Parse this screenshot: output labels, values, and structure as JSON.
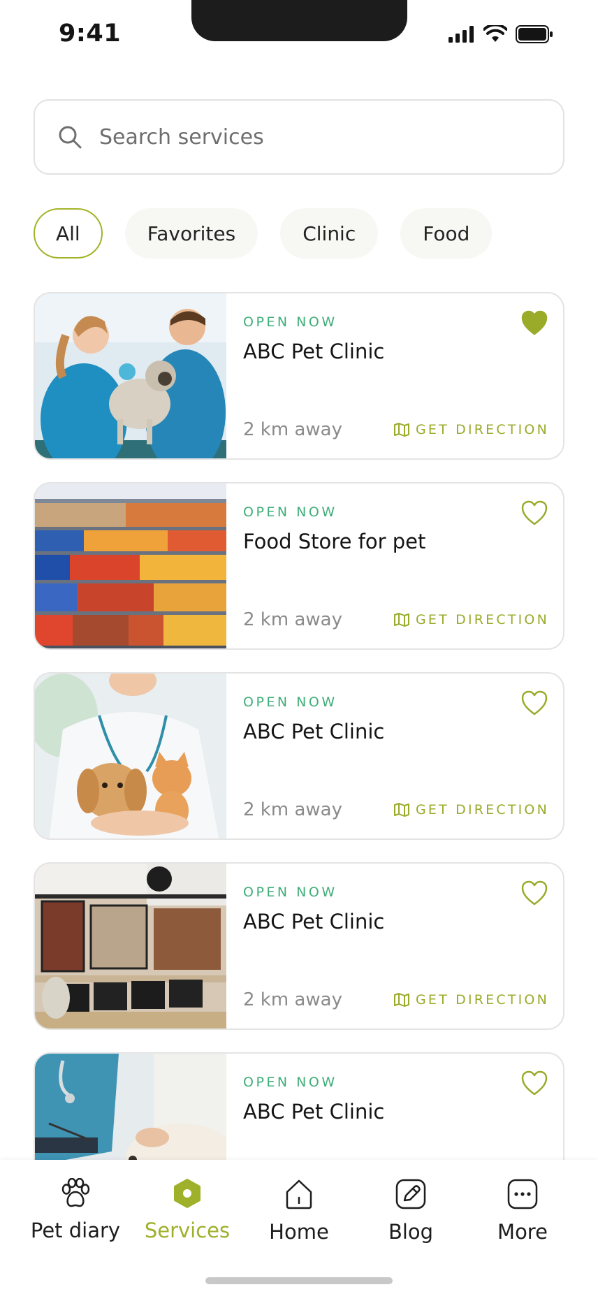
{
  "status": {
    "time": "9:41"
  },
  "search": {
    "placeholder": "Search services"
  },
  "filters": [
    {
      "label": "All",
      "active": true
    },
    {
      "label": "Favorites",
      "active": false
    },
    {
      "label": "Clinic",
      "active": false
    },
    {
      "label": "Food",
      "active": false
    }
  ],
  "services": [
    {
      "status": "OPEN NOW",
      "name": "ABC Pet Clinic",
      "distance": "2 km away",
      "direction_label": "GET DIRECTION",
      "favorite": true,
      "image": "vets-with-pug-photo"
    },
    {
      "status": "OPEN NOW",
      "name": "Food Store for pet",
      "distance": "2 km away",
      "direction_label": "GET DIRECTION",
      "favorite": false,
      "image": "pet-food-shelves-photo"
    },
    {
      "status": "OPEN NOW",
      "name": "ABC Pet Clinic",
      "distance": "2 km away",
      "direction_label": "GET DIRECTION",
      "favorite": false,
      "image": "vet-holding-puppy-kitten-photo"
    },
    {
      "status": "OPEN NOW",
      "name": "ABC Pet Clinic",
      "distance": "2 km away",
      "direction_label": "GET DIRECTION",
      "favorite": false,
      "image": "pet-grocer-store-photo"
    },
    {
      "status": "OPEN NOW",
      "name": "ABC Pet Clinic",
      "distance": "",
      "direction_label": "",
      "favorite": false,
      "image": "vet-with-dog-photo"
    }
  ],
  "nav": [
    {
      "label": "Pet diary",
      "icon": "paw-icon",
      "active": false
    },
    {
      "label": "Services",
      "icon": "hexagon-icon",
      "active": true
    },
    {
      "label": "Home",
      "icon": "home-icon",
      "active": false
    },
    {
      "label": "Blog",
      "icon": "edit-icon",
      "active": false
    },
    {
      "label": "More",
      "icon": "more-icon",
      "active": false
    }
  ],
  "colors": {
    "accent": "#9fb02a",
    "open": "#3fae78",
    "chip_bg": "#f7f7f4"
  }
}
